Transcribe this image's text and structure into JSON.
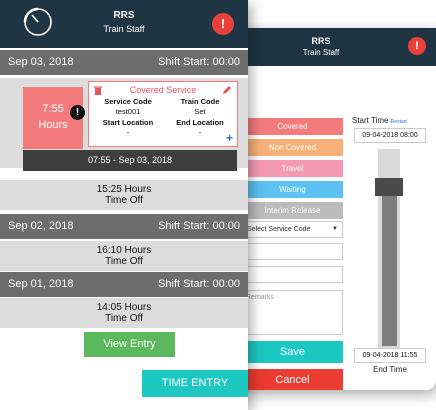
{
  "back": {
    "app_title": "RRS",
    "app_subtitle": "Train Staff",
    "info_glyph": "!",
    "status_buttons": [
      {
        "label": "Covered",
        "color": "#f37b7b"
      },
      {
        "label": "Non Covered",
        "color": "#f7b177"
      },
      {
        "label": "Travel",
        "color": "#f59ab4"
      },
      {
        "label": "Waiting",
        "color": "#5bc2f2"
      },
      {
        "label": "Interim Release",
        "color": "#bcbcbc"
      }
    ],
    "service_select": "Select Service Code",
    "remarks_placeholder": "Remarks",
    "save_label": "Save",
    "cancel_label": "Cancel",
    "start_time_label": "Start Time",
    "restart_label": "Restart",
    "start_time_value": "09-04-2018 08:00",
    "end_time_value": "09-04-2018 11:55",
    "end_time_label": "End Time"
  },
  "front": {
    "app_title": "RRS",
    "app_subtitle": "Train Staff",
    "info_glyph": "!",
    "days": [
      {
        "date": "Sep 03, 2018",
        "shift": "Shift Start: 00:00"
      },
      {
        "date": "Sep 02, 2018",
        "shift": "Shift Start: 00:00"
      },
      {
        "date": "Sep 01, 2018",
        "shift": "Shift Start: 00:00"
      }
    ],
    "entry": {
      "hours_value": "7:55",
      "hours_unit": "Hours",
      "service_title": "Covered Service",
      "service_code_label": "Service Code",
      "service_code_value": "test001",
      "train_code_label": "Train Code",
      "train_code_value": "Set",
      "start_location_label": "Start Location",
      "start_location_value": "-",
      "end_location_label": "End Location",
      "end_location_value": "-",
      "range": "07:55 - Sep 03, 2018"
    },
    "summaries": [
      {
        "hours": "15:25 Hours",
        "type": "Time Off"
      },
      {
        "hours": "16:10 Hours",
        "type": "Time Off"
      },
      {
        "hours": "14:05 Hours",
        "type": "Time Off"
      }
    ],
    "view_entry_label": "View Entry",
    "time_entry_label": "TIME ENTRY"
  }
}
